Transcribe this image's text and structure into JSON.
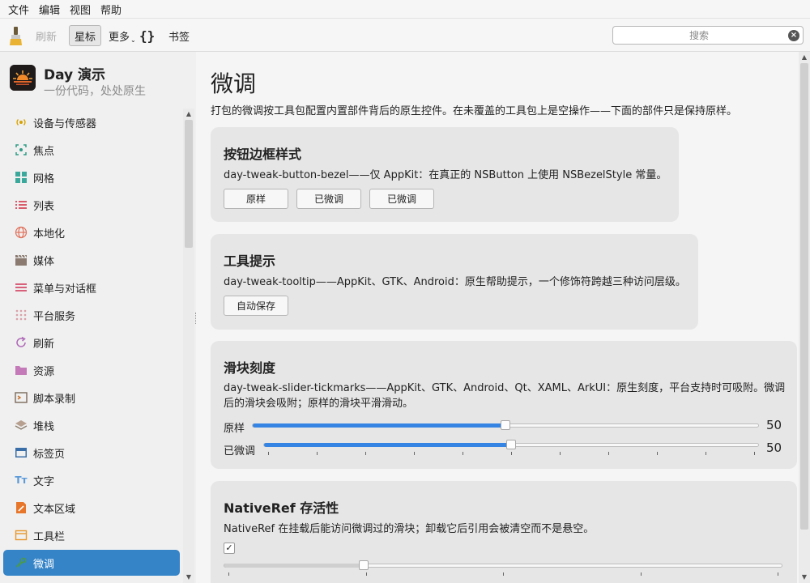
{
  "menubar": [
    "文件",
    "编辑",
    "视图",
    "帮助"
  ],
  "toolbar": {
    "refresh": "刷新",
    "star": "星标",
    "more": "更多",
    "braces": "{}",
    "bookmark": "书签",
    "search_placeholder": "搜索"
  },
  "app": {
    "title": "Day 演示",
    "subtitle": "一份代码，处处原生"
  },
  "sidebar": {
    "items": [
      {
        "label": "设备与传感器",
        "icon": "sensor-icon"
      },
      {
        "label": "焦点",
        "icon": "focus-icon"
      },
      {
        "label": "网格",
        "icon": "grid-icon"
      },
      {
        "label": "列表",
        "icon": "list-icon"
      },
      {
        "label": "本地化",
        "icon": "globe-icon"
      },
      {
        "label": "媒体",
        "icon": "clapper-icon"
      },
      {
        "label": "菜单与对话框",
        "icon": "menu-icon"
      },
      {
        "label": "平台服务",
        "icon": "dots-icon"
      },
      {
        "label": "刷新",
        "icon": "refresh-icon"
      },
      {
        "label": "资源",
        "icon": "folder-icon"
      },
      {
        "label": "脚本录制",
        "icon": "terminal-icon"
      },
      {
        "label": "堆栈",
        "icon": "stack-icon"
      },
      {
        "label": "标签页",
        "icon": "tabs-icon"
      },
      {
        "label": "文字",
        "icon": "text-icon"
      },
      {
        "label": "文本区域",
        "icon": "textarea-icon"
      },
      {
        "label": "工具栏",
        "icon": "toolbar-icon"
      },
      {
        "label": "微调",
        "icon": "tweak-icon"
      }
    ],
    "active_index": 16
  },
  "main": {
    "title": "微调",
    "description": "打包的微调按工具包配置内置部件背后的原生控件。在未覆盖的工具包上是空操作——下面的部件只是保持原样。",
    "cards": {
      "bezel": {
        "title": "按钮边框样式",
        "desc": "day-tweak-button-bezel——仅 AppKit：在真正的 NSButton 上使用 NSBezelStyle 常量。",
        "buttons": [
          "原样",
          "已微调",
          "已微调"
        ]
      },
      "tooltip": {
        "title": "工具提示",
        "desc": "day-tweak-tooltip——AppKit、GTK、Android：原生帮助提示，一个修饰符跨越三种访问层级。",
        "button": "自动保存"
      },
      "slider": {
        "title": "滑块刻度",
        "desc": "day-tweak-slider-tickmarks——AppKit、GTK、Android、Qt、XAML、ArkUI：原生刻度，平台支持时可吸附。微调后的滑块会吸附；原样的滑块平滑滑动。",
        "rows": [
          {
            "label": "原样",
            "value": "50",
            "fraction": 0.5
          },
          {
            "label": "已微调",
            "value": "50",
            "fraction": 0.5
          }
        ]
      },
      "nativeref": {
        "title": "NativeRef 存活性",
        "desc": "NativeRef 在挂载后能访问微调过的滑块；卸载它后引用会被清空而不是悬空。",
        "checked": "✓",
        "slider_fraction": 0.25
      }
    }
  },
  "colors": {
    "accent": "#3584c8",
    "slider_fill": "#3584e4",
    "card_bg": "#e6e6e6"
  }
}
